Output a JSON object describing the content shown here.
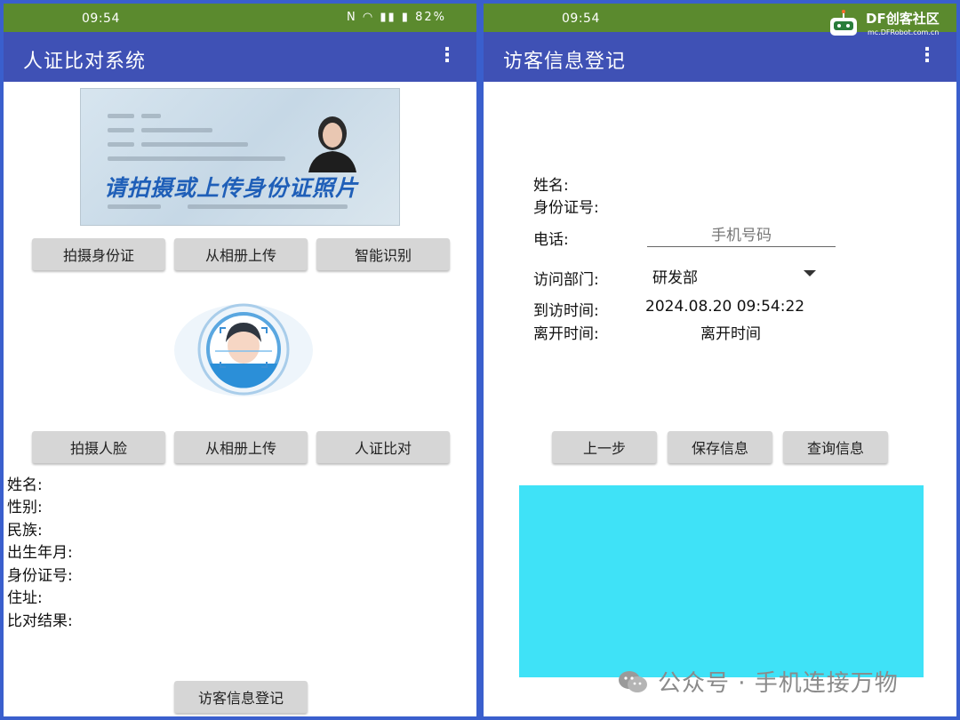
{
  "left": {
    "status": {
      "time": "09:54",
      "battery": "82%"
    },
    "appbar": {
      "title": "人证比对系统"
    },
    "idcard": {
      "prompt": "请拍摄或上传身份证照片"
    },
    "buttons_row1": {
      "capture_id": "拍摄身份证",
      "upload_album": "从相册上传",
      "smart_recognize": "智能识别"
    },
    "buttons_row2": {
      "capture_face": "拍摄人脸",
      "upload_album": "从相册上传",
      "compare": "人证比对"
    },
    "fields": {
      "name": "姓名:",
      "gender": "性别:",
      "ethnicity": "民族:",
      "birth": "出生年月:",
      "id_number": "身份证号:",
      "address": "住址:",
      "result": "比对结果:"
    },
    "visitor_button": "访客信息登记"
  },
  "right": {
    "status": {
      "time": "09:54"
    },
    "appbar": {
      "title": "访客信息登记"
    },
    "labels": {
      "name": "姓名:",
      "id_number": "身份证号:",
      "phone": "电话:",
      "department": "访问部门:",
      "arrive_time": "到访时间:",
      "leave_time": "离开时间:"
    },
    "phone_placeholder": "手机号码",
    "department_value": "研发部",
    "arrive_value": "2024.08.20 09:54:22",
    "leave_value": "离开时间",
    "buttons": {
      "prev": "上一步",
      "save": "保存信息",
      "query": "查询信息"
    },
    "result_box_color": "#3fe2f7"
  },
  "watermark": {
    "text": "公众号 · 手机连接万物"
  },
  "logo": {
    "brand": "DF创客社区",
    "sub": "mc.DFRobot.com.cn"
  },
  "colors": {
    "appbar": "#3f51b5",
    "statusbar": "#5b8a2e",
    "border": "#3a5fcd"
  }
}
